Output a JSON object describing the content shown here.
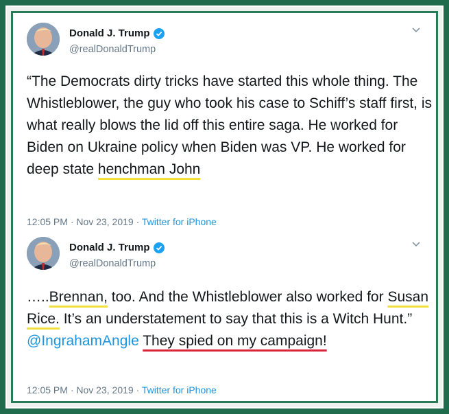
{
  "colors": {
    "frame": "#1f6b4c",
    "link": "#1b95e0",
    "verified": "#1da1f2",
    "highlight_yellow": "#f2e03a",
    "highlight_red": "#d8233a"
  },
  "tweets": [
    {
      "author_name": "Donald J. Trump",
      "handle": "@realDonaldTrump",
      "text_part1": "“The Democrats dirty tricks have started this whole thing. The Whistleblower, the guy who took his case to Schiff’s staff first, is what really blows the lid off this entire saga. He worked for Biden on Ukraine policy when Biden was VP. He worked for deep state ",
      "text_highlight": "henchman John",
      "time": "12:05 PM",
      "date": "Nov 23, 2019",
      "source": "Twitter for iPhone"
    },
    {
      "author_name": "Donald J. Trump",
      "handle": "@realDonaldTrump",
      "text_lead": "…..",
      "text_hl1": "Brennan,",
      "text_mid1": " too. And the Whistleblower also worked for ",
      "text_hl2": "Susan Rice.",
      "text_mid2": " It’s an understatement to say that this is a Witch Hunt.” ",
      "mention": "@IngrahamAngle",
      "text_gap": "  ",
      "text_hl3": "They spied on my campaign!",
      "time": "12:05 PM",
      "date": "Nov 23, 2019",
      "source": "Twitter for iPhone"
    }
  ],
  "icons": {
    "verified": "verified-badge-icon",
    "caret": "chevron-down-icon"
  }
}
